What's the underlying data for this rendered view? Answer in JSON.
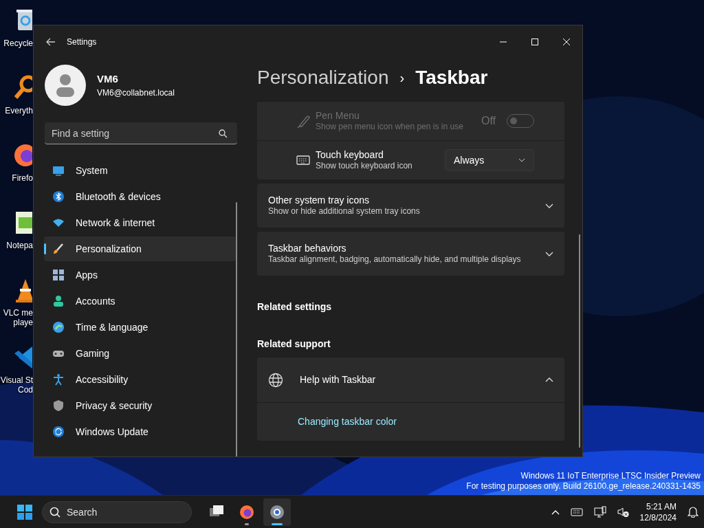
{
  "desktop_icons": [
    {
      "kind": "recycle",
      "label_lines": [
        "Recycle"
      ]
    },
    {
      "kind": "search",
      "label_lines": [
        "Everyth"
      ]
    },
    {
      "kind": "firefox",
      "label_lines": [
        "Firefo"
      ]
    },
    {
      "kind": "notepad",
      "label_lines": [
        "Notepa"
      ]
    },
    {
      "kind": "vlc",
      "label_lines": [
        "VLC me",
        "playe"
      ]
    },
    {
      "kind": "vscode",
      "label_lines": [
        "Visual St",
        "Cod"
      ]
    }
  ],
  "window": {
    "title": "Settings",
    "account": {
      "name": "VM6",
      "email": "VM6@collabnet.local"
    },
    "search": {
      "placeholder": "Find a setting"
    },
    "nav_items": [
      {
        "kind": "system",
        "label": "System",
        "selected": false
      },
      {
        "kind": "bluetooth",
        "label": "Bluetooth & devices",
        "selected": false
      },
      {
        "kind": "network",
        "label": "Network & internet",
        "selected": false
      },
      {
        "kind": "personalization",
        "label": "Personalization",
        "selected": true
      },
      {
        "kind": "apps",
        "label": "Apps",
        "selected": false
      },
      {
        "kind": "accounts",
        "label": "Accounts",
        "selected": false
      },
      {
        "kind": "time",
        "label": "Time & language",
        "selected": false
      },
      {
        "kind": "gaming",
        "label": "Gaming",
        "selected": false
      },
      {
        "kind": "accessibility",
        "label": "Accessibility",
        "selected": false
      },
      {
        "kind": "privacy",
        "label": "Privacy & security",
        "selected": false
      },
      {
        "kind": "update",
        "label": "Windows Update",
        "selected": false
      }
    ],
    "breadcrumb": {
      "parent": "Personalization",
      "separator": "›",
      "current": "Taskbar"
    },
    "setting_rows": [
      {
        "kind": "toggle",
        "title": "Pen Menu",
        "description": "Show pen menu icon when pen is in use",
        "disabled": true,
        "on": false,
        "state_label": "Off"
      },
      {
        "kind": "dropdown",
        "title": "Touch keyboard",
        "description": "Show touch keyboard icon",
        "disabled": false,
        "value": "Always"
      }
    ],
    "expanders": [
      {
        "title": "Other system tray icons",
        "description": "Show or hide additional system tray icons",
        "expanded": false
      },
      {
        "title": "Taskbar behaviors",
        "description": "Taskbar alignment, badging, automatically hide, and multiple displays",
        "expanded": false
      }
    ],
    "related_settings": {
      "heading": "Related settings"
    },
    "related_support": {
      "heading": "Related support",
      "title": "Help with Taskbar",
      "expanded": true,
      "links": [
        "Changing taskbar color"
      ]
    }
  },
  "build_info": [
    "Windows 11 IoT Enterprise LTSC Insider Preview",
    "For testing purposes only. Build 26100.ge_release.240331-1435"
  ],
  "taskbar": {
    "search_placeholder": "Search",
    "apps": [
      {
        "kind": "taskview",
        "running": false,
        "selected": false
      },
      {
        "kind": "firefox",
        "running": true,
        "selected": false
      },
      {
        "kind": "settings",
        "running": true,
        "selected": true
      }
    ],
    "time": "5:21 AM",
    "date": "12/8/2024"
  }
}
